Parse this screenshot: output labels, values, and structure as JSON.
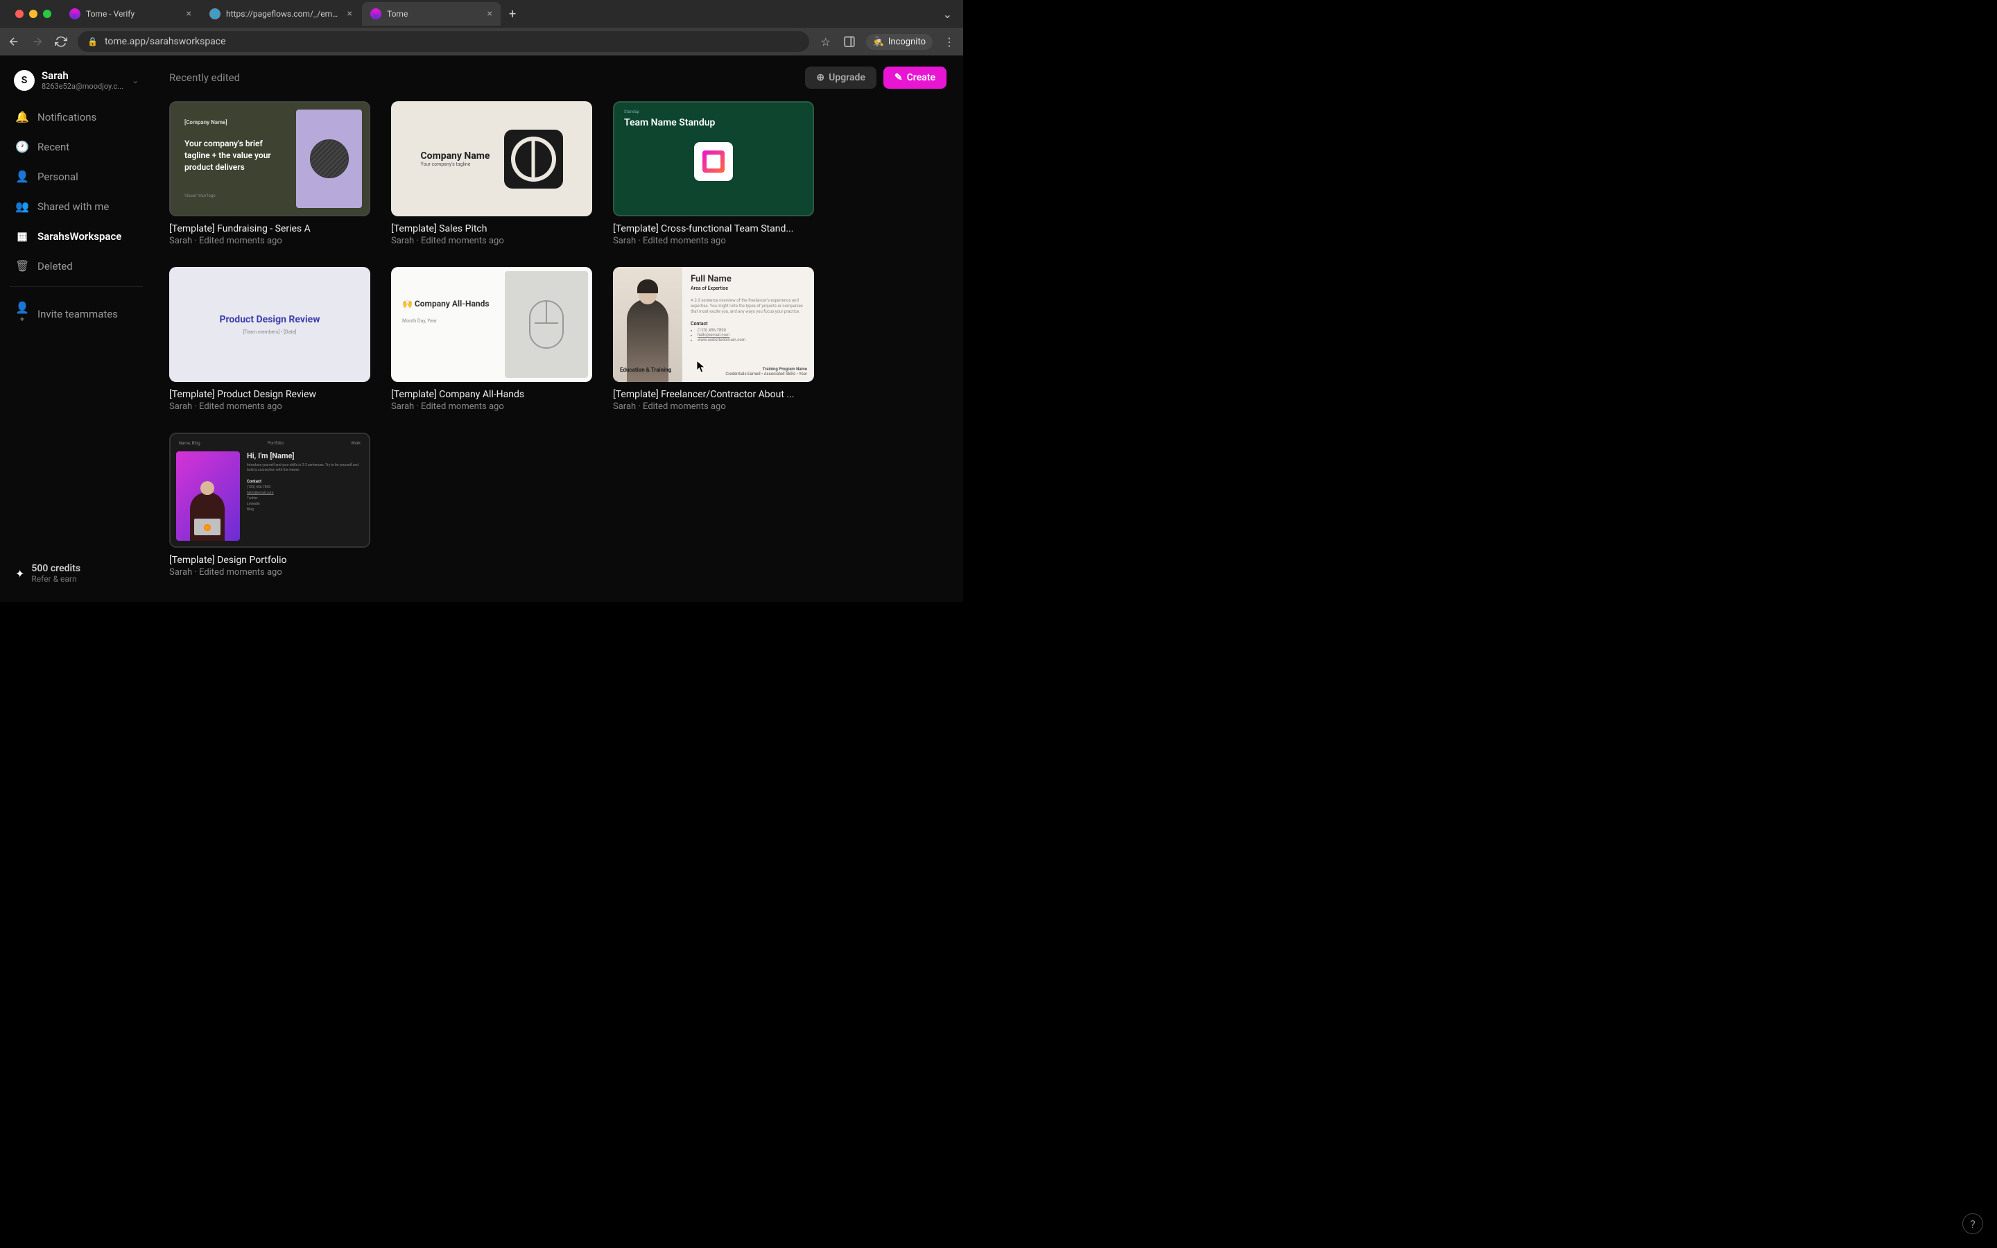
{
  "browser": {
    "tabs": [
      {
        "title": "Tome - Verify",
        "favicon_color": "#e815d3"
      },
      {
        "title": "https://pageflows.com/_/email...",
        "favicon_color": "#888"
      },
      {
        "title": "Tome",
        "favicon_color": "#e815d3"
      }
    ],
    "url": "tome.app/sarahsworkspace",
    "incognito_label": "Incognito"
  },
  "user": {
    "name": "Sarah",
    "email": "8263e52a@moodjoy.c...",
    "initial": "S"
  },
  "sidebar": {
    "items": [
      {
        "label": "Notifications",
        "icon": "bell"
      },
      {
        "label": "Recent",
        "icon": "clock"
      },
      {
        "label": "Personal",
        "icon": "person"
      },
      {
        "label": "Shared with me",
        "icon": "people"
      },
      {
        "label": "SarahsWorkspace",
        "icon": "grid",
        "active": true
      },
      {
        "label": "Deleted",
        "icon": "trash"
      }
    ],
    "invite_label": "Invite teammates",
    "credits_title": "500 credits",
    "credits_sub": "Refer & earn"
  },
  "header": {
    "section_title": "Recently edited",
    "upgrade_label": "Upgrade",
    "create_label": "Create"
  },
  "cards": [
    {
      "title": "[Template] Fundraising - Series A",
      "author": "Sarah",
      "edited": "Edited moments ago",
      "thumb": {
        "company_name": "[Company Name]",
        "tagline": "Your company's brief tagline + the value your product delivers",
        "visual": "Visual: Your logo"
      }
    },
    {
      "title": "[Template] Sales Pitch",
      "author": "Sarah",
      "edited": "Edited moments ago",
      "thumb": {
        "company_name": "Company Name",
        "tagline": "Your company's tagline"
      }
    },
    {
      "title": "[Template] Cross-functional Team Stand...",
      "author": "Sarah",
      "edited": "Edited moments ago",
      "thumb": {
        "label": "Standup",
        "title": "Team Name Standup"
      }
    },
    {
      "title": "[Template] Product Design Review",
      "author": "Sarah",
      "edited": "Edited moments ago",
      "thumb": {
        "title": "Product Design Review",
        "sub": "[Team members] • [Date]"
      }
    },
    {
      "title": "[Template] Company All-Hands",
      "author": "Sarah",
      "edited": "Edited moments ago",
      "thumb": {
        "title": "🙌 Company All-Hands",
        "date": "Month Day, Year"
      }
    },
    {
      "title": "[Template] Freelancer/Contractor About ...",
      "author": "Sarah",
      "edited": "Edited moments ago",
      "thumb": {
        "name": "Full Name",
        "area": "Area of Expertise",
        "desc": "A 2-3 sentence overview of the freelancer's experience and expertise. You might note the types of projects or companies that most excite you, and any ways you focus your practice.",
        "contact_label": "Contact",
        "phone": "(123) 456-7890",
        "email": "hello@email.com",
        "website": "www.websitedomain.com",
        "edu": "Education & Training",
        "program": "Training Program Name",
        "creds": "Credentials Earned • Associated Skills • Year"
      }
    },
    {
      "title": "[Template] Design Portfolio",
      "author": "Sarah",
      "edited": "Edited moments ago",
      "thumb": {
        "nav1": "Name, Blog",
        "nav2": "Portfolio",
        "nav3": "Work",
        "hi": "Hi, I'm [Name]",
        "desc": "Introduce yourself and your skills in 2-3 sentences. Try to be yourself and build a connection with the viewer.",
        "contact_label": "Contact",
        "phone": "(123) 456-7890",
        "email": "hello@email.com",
        "twitter": "Twitter",
        "linkedin": "LinkedIn",
        "blog": "Blog"
      }
    }
  ]
}
